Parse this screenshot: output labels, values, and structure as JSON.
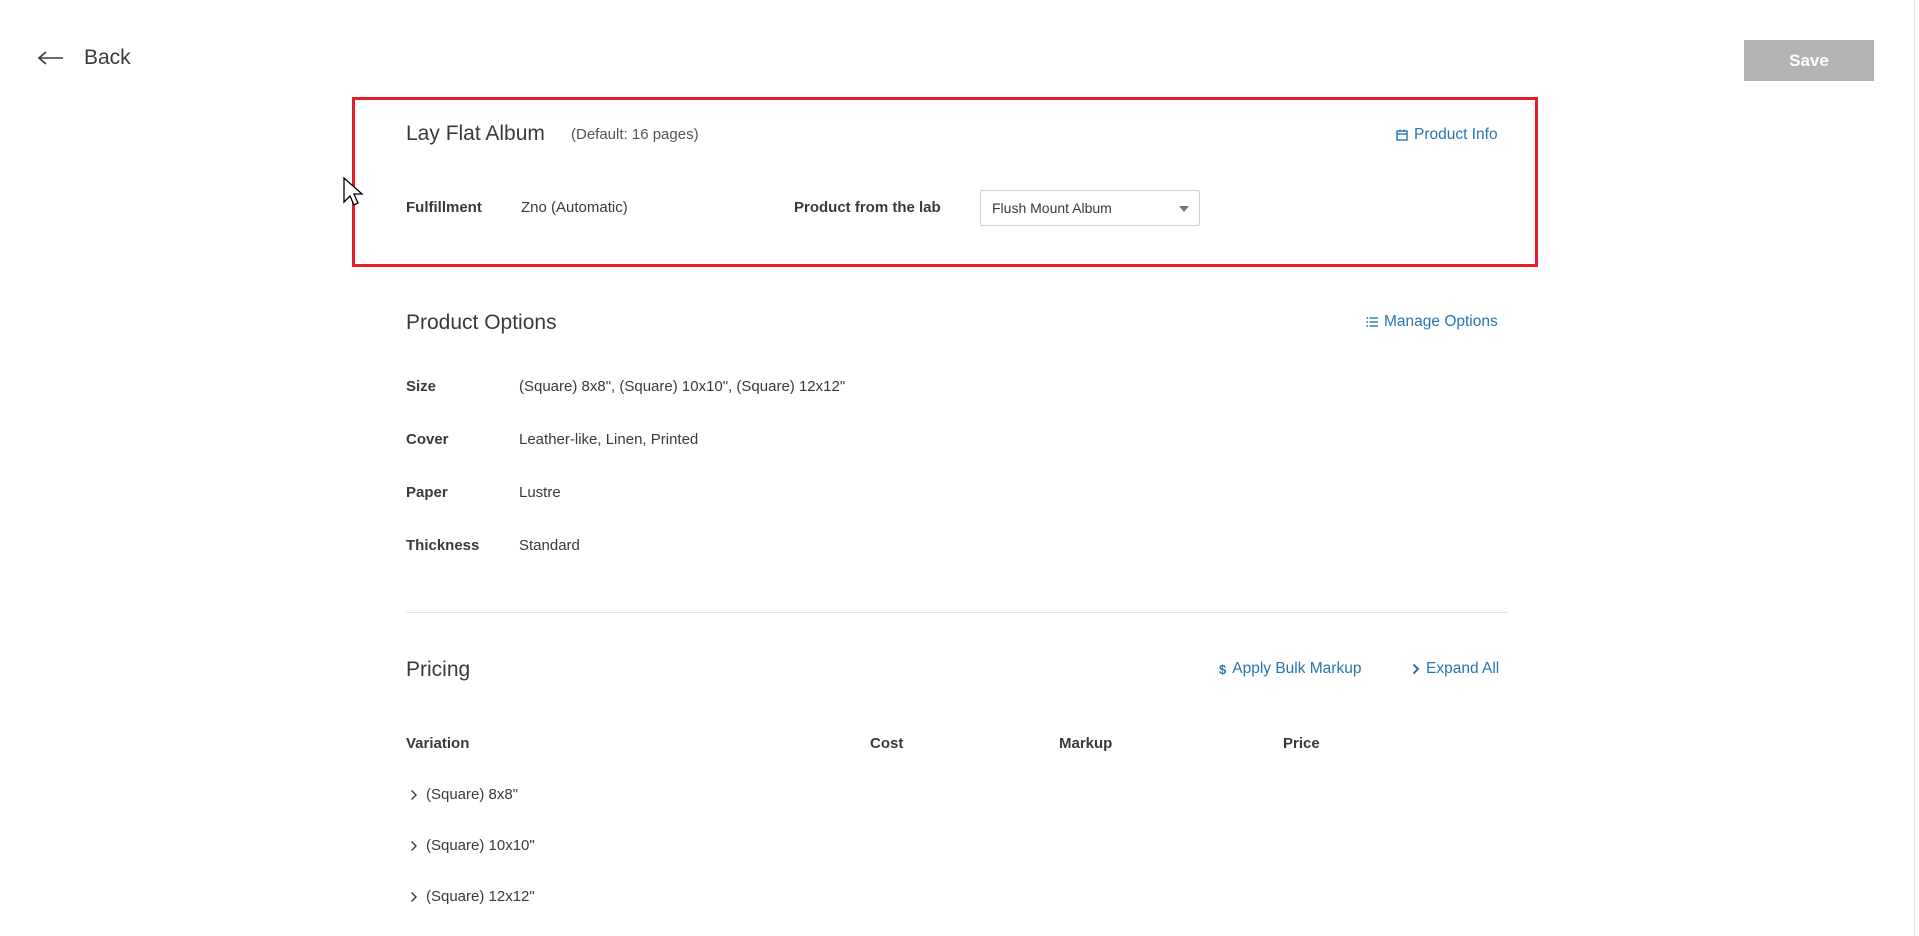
{
  "header": {
    "back_label": "Back",
    "save_label": "Save"
  },
  "product": {
    "title": "Lay Flat Album",
    "default_note": "(Default: 16 pages)",
    "info_link": "Product Info",
    "fulfillment_label": "Fulfillment",
    "fulfillment_value": "Zno (Automatic)",
    "lab_product_label": "Product from the lab",
    "lab_product_selected": "Flush Mount Album"
  },
  "options": {
    "title": "Product Options",
    "manage_link": "Manage Options",
    "rows": [
      {
        "label": "Size",
        "value": "(Square) 8x8\", (Square) 10x10\", (Square) 12x12\""
      },
      {
        "label": "Cover",
        "value": "Leather-like, Linen, Printed"
      },
      {
        "label": "Paper",
        "value": "Lustre"
      },
      {
        "label": "Thickness",
        "value": "Standard"
      }
    ]
  },
  "pricing": {
    "title": "Pricing",
    "bulk_markup_link": "Apply Bulk Markup",
    "expand_all_link": "Expand All",
    "columns": [
      "Variation",
      "Cost",
      "Markup",
      "Price"
    ],
    "variations": [
      "(Square) 8x8\"",
      "(Square) 10x10\"",
      "(Square) 12x12\""
    ]
  },
  "colors": {
    "link": "#2a74b0",
    "highlight_border": "#e21e2d",
    "save_disabled": "#b3b3b3"
  }
}
